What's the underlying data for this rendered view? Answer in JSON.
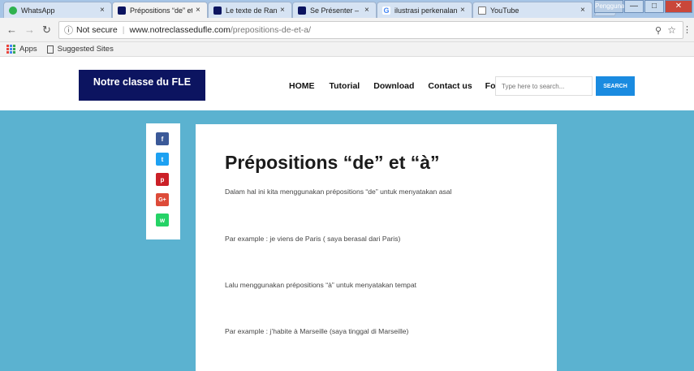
{
  "browser": {
    "tabs": [
      {
        "title": "WhatsApp",
        "favicon_color": "#2fb24f"
      },
      {
        "title": "Prépositions “de” et “à",
        "favicon_color": "#0c1460",
        "active": true
      },
      {
        "title": "Le texte de Rani – Notr",
        "favicon_color": "#0c1460"
      },
      {
        "title": "Se Présenter – Notre C",
        "favicon_color": "#0c1460"
      },
      {
        "title": "ilustrasi perkenalan di",
        "favicon_color": "#4285f4",
        "icon_text": "G"
      },
      {
        "title": "YouTube",
        "favicon_color": "#ffffff"
      }
    ],
    "close_glyph": "×",
    "window_buttons": {
      "user": "Pengguna",
      "minimize": "—",
      "maximize": "□",
      "close": "✕"
    },
    "address": {
      "security": "Not secure",
      "host": "www.notreclassedufle.com",
      "path": "/prepositions-de-et-a/"
    },
    "bookmarks": [
      "Apps",
      "Suggested Sites"
    ]
  },
  "site": {
    "logo": "Notre classe du FLE",
    "menu": [
      "HOME",
      "Tutorial",
      "Download",
      "Contact us",
      "Forum"
    ],
    "search_placeholder": "Type here to search...",
    "search_button": "SEARCH"
  },
  "share": [
    {
      "name": "facebook",
      "glyph": "f",
      "color": "#3b5998"
    },
    {
      "name": "twitter",
      "glyph": "t",
      "color": "#1da1f2"
    },
    {
      "name": "pinterest",
      "glyph": "p",
      "color": "#cb2027"
    },
    {
      "name": "google-plus",
      "glyph": "G+",
      "color": "#dd4b39"
    },
    {
      "name": "whatsapp",
      "glyph": "w",
      "color": "#25d366"
    }
  ],
  "article": {
    "title": "Prépositions “de” et “à”",
    "paragraphs": [
      "Dalam hal ini kita menggunakan prépositions “de” untuk menyatakan asal",
      "Par example  : je viens de Paris ( saya berasal dari Paris)",
      "Lalu menggunakan prépositions “à” untuk menyatakan tempat",
      "Par example : j’habite à Marseille (saya tinggal di Marseille)"
    ]
  }
}
